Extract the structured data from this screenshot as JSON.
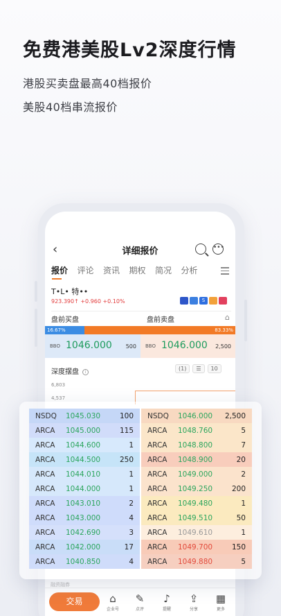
{
  "hero": {
    "title": "免费港美股Lv2深度行情",
    "sub1": "港股买卖盘最高40档报价",
    "sub2": "美股40档串流报价"
  },
  "nav": {
    "back_icon": "‹",
    "title": "详细报价"
  },
  "tabs": [
    "报价",
    "评论",
    "资讯",
    "期权",
    "简况",
    "分析"
  ],
  "stock": {
    "name": "T•L•  特••",
    "price_line": "923.390↑ +0.960  +0.10%"
  },
  "flags": [
    {
      "label": "",
      "color": "#2d56c9"
    },
    {
      "label": "",
      "color": "#3b7fe0"
    },
    {
      "label": "S",
      "color": "#2f6fe0"
    },
    {
      "label": "",
      "color": "#f2a13a"
    },
    {
      "label": "",
      "color": "#e2405e"
    }
  ],
  "premarket": {
    "buy_label": "盘前买盘",
    "sell_label": "盘前卖盘",
    "bank_icon": "bank-icon"
  },
  "ratio": {
    "buy": "16.67%",
    "sell": "83.33%"
  },
  "bbo": {
    "label": "BBO",
    "buy_price": "1046.000",
    "buy_vol": "500",
    "sell_price": "1046.000",
    "sell_vol": "2,500"
  },
  "depth": {
    "title": "深度摆盘",
    "info": "i",
    "tool1": "(1)",
    "tool2": "☰",
    "tool3": "10",
    "axis1": "6,803",
    "axis2": "4,537"
  },
  "bottom": {
    "trade": "交易",
    "items": [
      {
        "glyph": "⌂",
        "label": "企业号"
      },
      {
        "glyph": "✎",
        "label": "点评"
      },
      {
        "glyph": "♪",
        "label": "提醒"
      },
      {
        "glyph": "⇪",
        "label": "分享"
      },
      {
        "glyph": "▦",
        "label": "更多"
      }
    ],
    "partial": "融资融券"
  },
  "orderbook": {
    "bids": [
      {
        "ex": "NSDQ",
        "px": "1045.030",
        "qty": "100"
      },
      {
        "ex": "ARCA",
        "px": "1045.000",
        "qty": "115"
      },
      {
        "ex": "ARCA",
        "px": "1044.600",
        "qty": "1"
      },
      {
        "ex": "ARCA",
        "px": "1044.500",
        "qty": "250"
      },
      {
        "ex": "ARCA",
        "px": "1044.010",
        "qty": "1"
      },
      {
        "ex": "ARCA",
        "px": "1044.000",
        "qty": "1"
      },
      {
        "ex": "ARCA",
        "px": "1043.010",
        "qty": "2"
      },
      {
        "ex": "ARCA",
        "px": "1043.000",
        "qty": "4"
      },
      {
        "ex": "ARCA",
        "px": "1042.690",
        "qty": "3"
      },
      {
        "ex": "ARCA",
        "px": "1042.000",
        "qty": "17"
      },
      {
        "ex": "ARCA",
        "px": "1040.850",
        "qty": "4"
      }
    ],
    "asks": [
      {
        "ex": "NSDQ",
        "px": "1046.000",
        "qty": "2,500"
      },
      {
        "ex": "ARCA",
        "px": "1048.760",
        "qty": "5"
      },
      {
        "ex": "ARCA",
        "px": "1048.800",
        "qty": "7"
      },
      {
        "ex": "ARCA",
        "px": "1048.900",
        "qty": "20"
      },
      {
        "ex": "ARCA",
        "px": "1049.000",
        "qty": "2"
      },
      {
        "ex": "ARCA",
        "px": "1049.250",
        "qty": "200"
      },
      {
        "ex": "ARCA",
        "px": "1049.480",
        "qty": "1"
      },
      {
        "ex": "ARCA",
        "px": "1049.510",
        "qty": "50"
      },
      {
        "ex": "ARCA",
        "px": "1049.610",
        "qty": "1"
      },
      {
        "ex": "ARCA",
        "px": "1049.700",
        "qty": "150"
      },
      {
        "ex": "ARCA",
        "px": "1049.880",
        "qty": "5"
      }
    ]
  }
}
